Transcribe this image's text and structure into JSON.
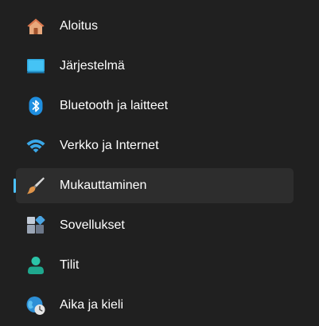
{
  "nav": {
    "items": [
      {
        "label": "Aloitus",
        "icon": "home-icon"
      },
      {
        "label": "Järjestelmä",
        "icon": "monitor-icon"
      },
      {
        "label": "Bluetooth ja laitteet",
        "icon": "bluetooth-icon"
      },
      {
        "label": "Verkko ja Internet",
        "icon": "wifi-icon"
      },
      {
        "label": "Mukauttaminen",
        "icon": "paintbrush-icon",
        "selected": true
      },
      {
        "label": "Sovellukset",
        "icon": "apps-icon"
      },
      {
        "label": "Tilit",
        "icon": "person-icon"
      },
      {
        "label": "Aika ja kieli",
        "icon": "globe-clock-icon"
      }
    ]
  },
  "colors": {
    "background": "#202020",
    "selected_background": "#2d2d2d",
    "accent": "#4cc2ff",
    "text": "#ffffff"
  }
}
